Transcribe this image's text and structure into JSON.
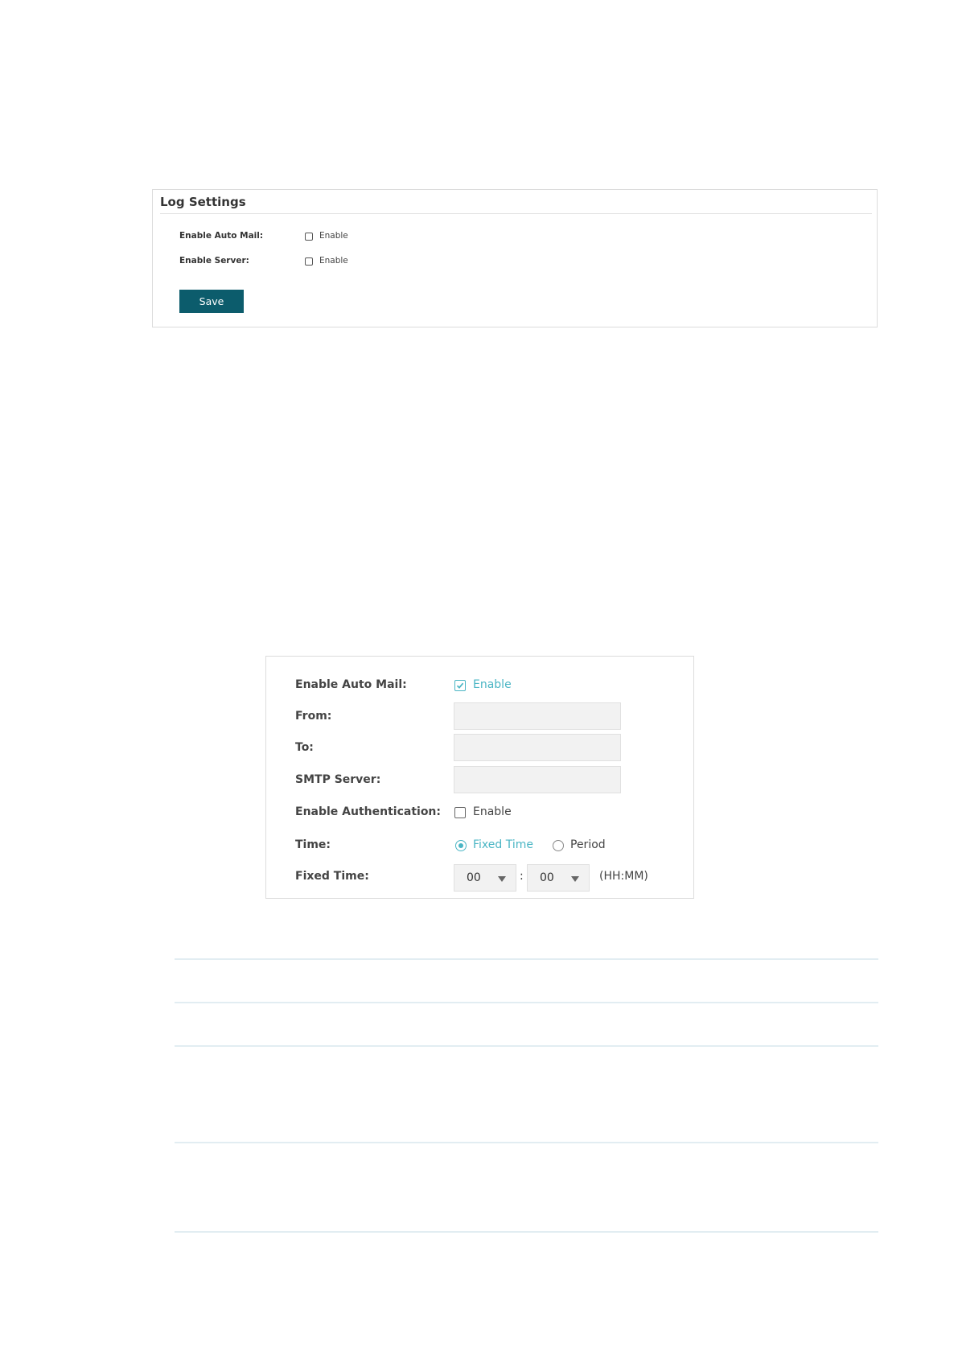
{
  "log_settings": {
    "title": "Log Settings",
    "auto_mail": {
      "label": "Enable Auto Mail:",
      "option": "Enable",
      "checked": false
    },
    "server": {
      "label": "Enable Server:",
      "option": "Enable",
      "checked": false
    },
    "save_label": "Save",
    "button_color": "#0c5c6c"
  },
  "auto_mail_form": {
    "enable_auto_mail": {
      "label": "Enable Auto Mail:",
      "option": "Enable",
      "checked": true
    },
    "from": {
      "label": "From:",
      "value": ""
    },
    "to": {
      "label": "To:",
      "value": ""
    },
    "smtp_server": {
      "label": "SMTP Server:",
      "value": ""
    },
    "enable_authentication": {
      "label": "Enable Authentication:",
      "option": "Enable",
      "checked": false
    },
    "time": {
      "label": "Time:",
      "options": [
        {
          "label": "Fixed Time",
          "selected": true
        },
        {
          "label": "Period",
          "selected": false
        }
      ]
    },
    "fixed_time": {
      "label": "Fixed Time:",
      "hour": "00",
      "minute": "00",
      "separator": ":",
      "hint": "(HH:MM)"
    },
    "accent_color": "#4ab5c4"
  }
}
